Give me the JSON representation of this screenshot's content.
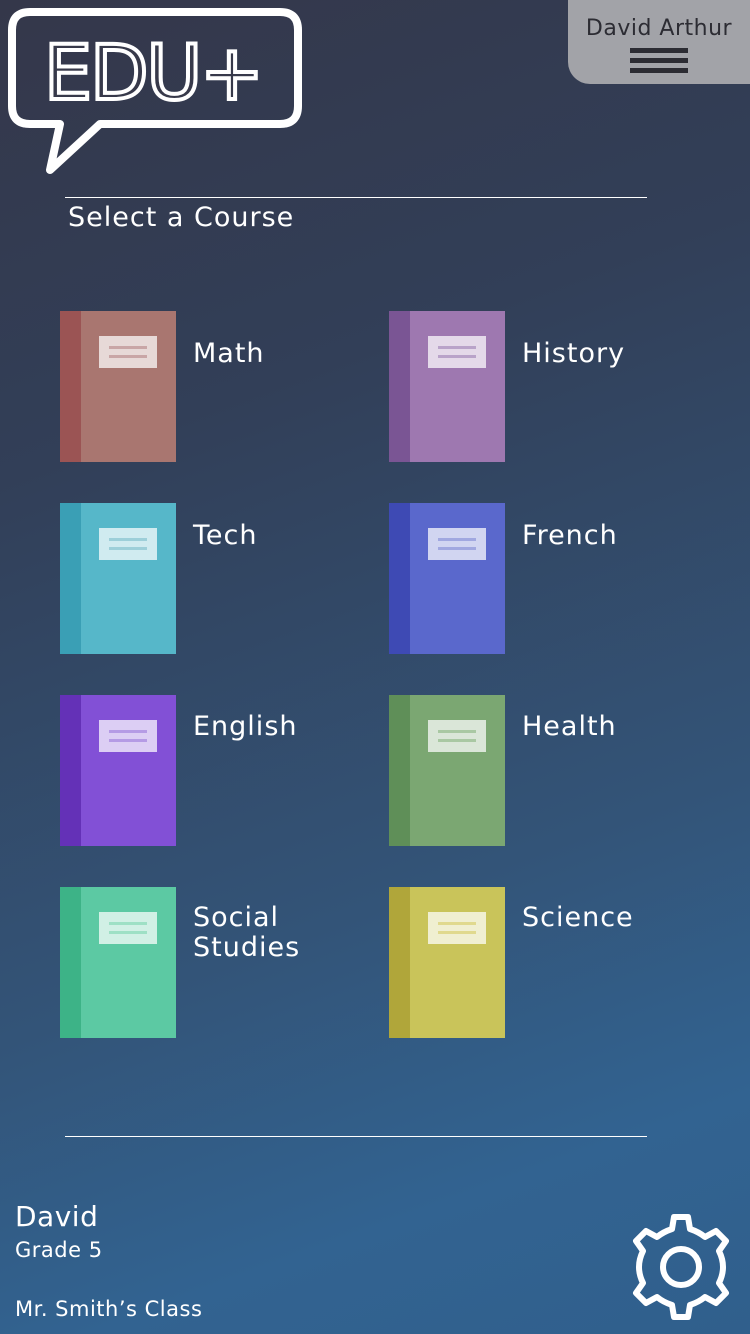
{
  "logo": {
    "text": "EDU+"
  },
  "user": {
    "name": "David Arthur",
    "menu_icon": "hamburger-menu-icon"
  },
  "page": {
    "title": "Select a Course"
  },
  "courses": [
    {
      "name": "Math",
      "spine": "#9b5454",
      "cover": "#a97670",
      "line": "#c9a6a6"
    },
    {
      "name": "History",
      "spine": "#7a5594",
      "cover": "#9e78b0",
      "line": "#b9a3c9"
    },
    {
      "name": "Tech",
      "spine": "#3a9fb5",
      "cover": "#56b7c9",
      "line": "#9dcfd9"
    },
    {
      "name": "French",
      "spine": "#3e4ab4",
      "cover": "#5a68cc",
      "line": "#a1a8e0"
    },
    {
      "name": "English",
      "spine": "#6431b7",
      "cover": "#8250d6",
      "line": "#b59be5"
    },
    {
      "name": "Health",
      "spine": "#5f8f58",
      "cover": "#7ba772",
      "line": "#a9c8a3"
    },
    {
      "name": "Social Studies",
      "spine": "#3db387",
      "cover": "#5cc9a3",
      "line": "#9ee0c5"
    },
    {
      "name": "Science",
      "spine": "#b0a63a",
      "cover": "#c9c45a",
      "line": "#e0d98e"
    }
  ],
  "student": {
    "name": "David",
    "grade": "Grade 5",
    "class": "Mr. Smith’s Class"
  },
  "settings": {
    "icon": "gear-icon"
  }
}
